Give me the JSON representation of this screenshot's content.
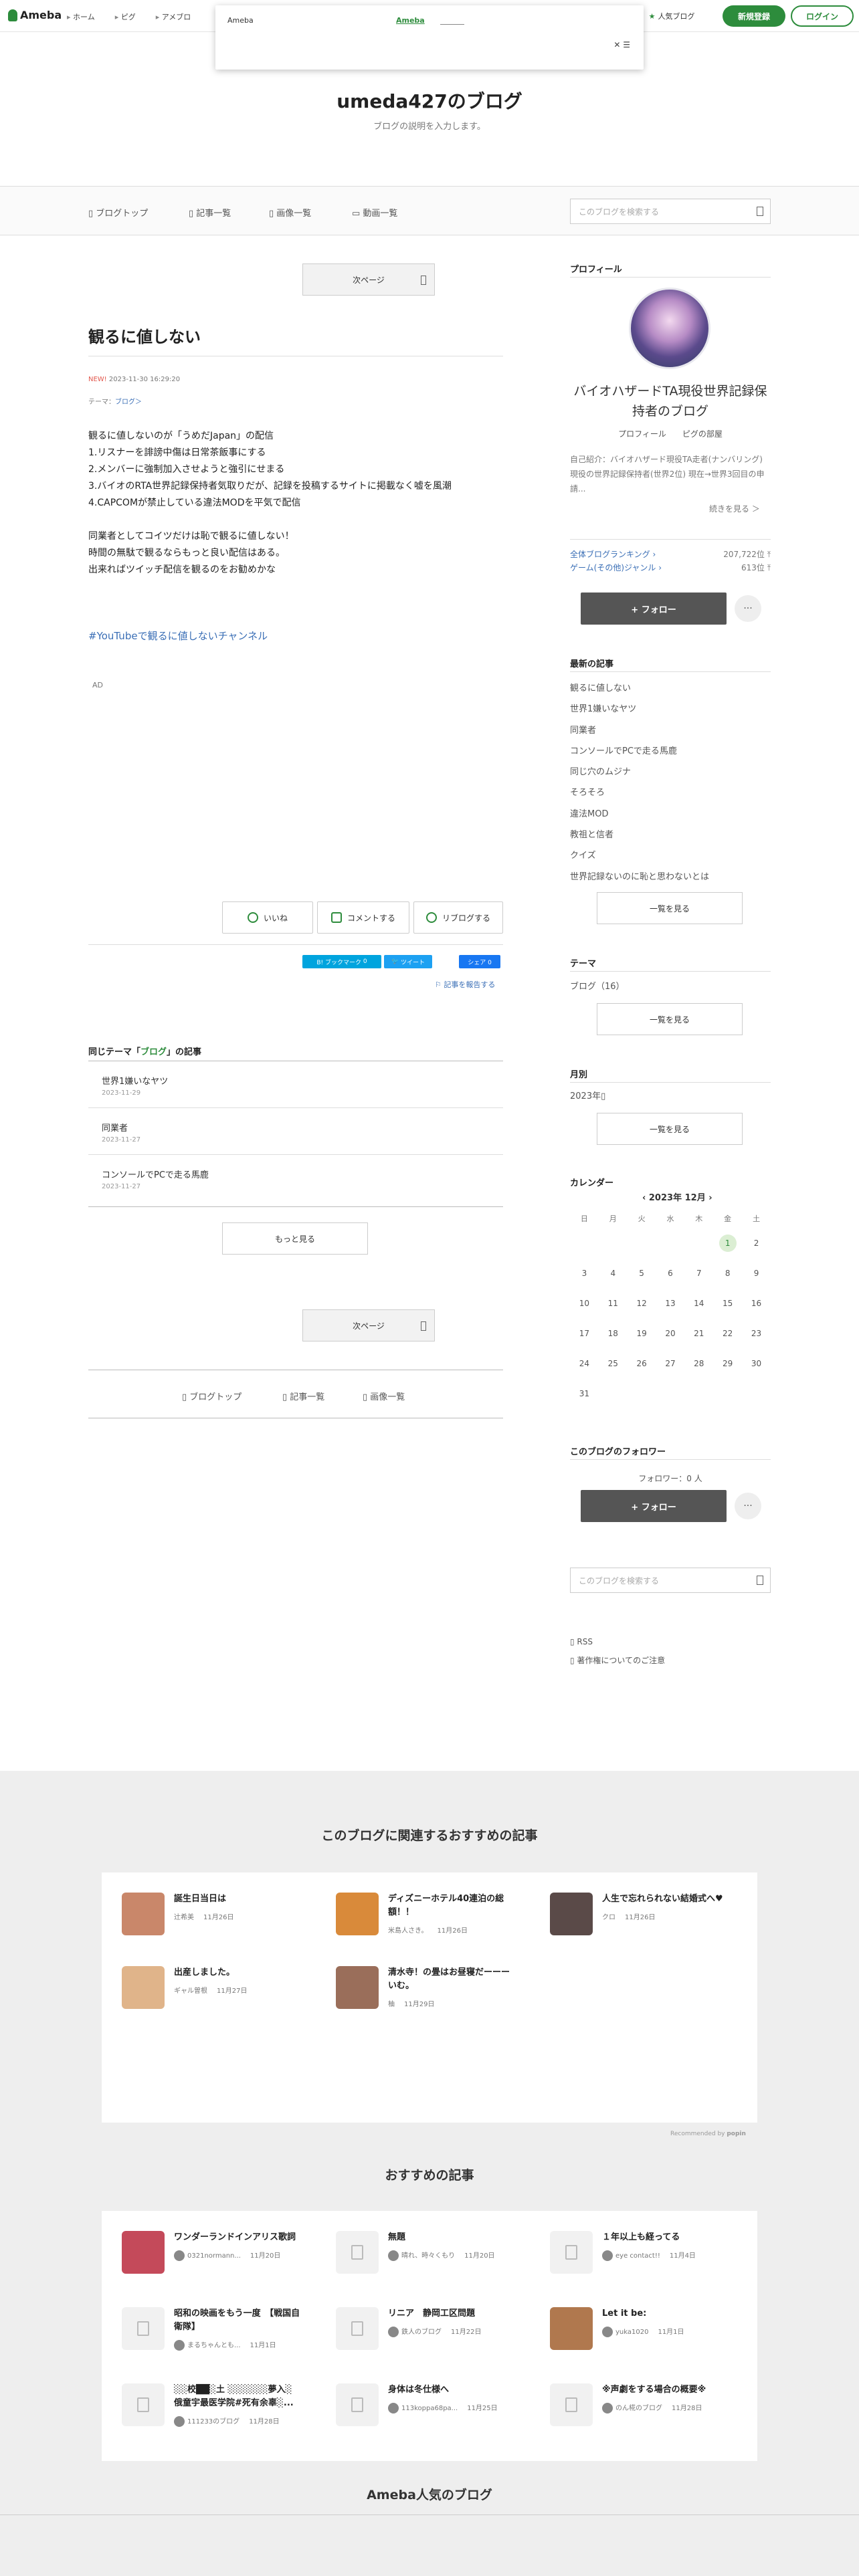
{
  "global_header": {
    "logo": "Ameba",
    "nav": [
      "ホーム",
      "ピグ",
      "アメブロ"
    ],
    "popular_label": "人気ブログ",
    "signup_label": "新規登録",
    "login_label": "ログイン",
    "popup": {
      "left_text": "Ameba",
      "link_text": "Ameba",
      "close_label": "✕"
    }
  },
  "blog": {
    "title": "umeda427のブログ",
    "description": "ブログの説明を入力します。"
  },
  "blog_nav": {
    "items": [
      "ブログトップ",
      "記事一覧",
      "画像一覧",
      "動画一覧"
    ],
    "search_placeholder": "このブログを検索する"
  },
  "article": {
    "next_page": "次ページ",
    "title": "観るに値しない",
    "new_badge": "NEW!",
    "date": "2023-11-30 16:29:20",
    "theme_label": "テーマ：",
    "theme": "ブログ",
    "body_lines": [
      "観るに値しないのが「うめだJapan」の配信",
      "1.リスナーを誹謗中傷は日常茶飯事にする",
      "2.メンバーに強制加入させようと強引にせまる",
      "3.バイオのRTA世界記録保持者気取りだが、記録を投稿するサイトに掲載なく嘘を風潮",
      "4.CAPCOMが禁止している違法MODを平気で配信",
      "",
      "同業者としてコイツだけは恥で観るに値しない！",
      "時間の無駄で観るならもっと良い配信はある。",
      "出来ればツイッチ配信を観るのをお勧めかな"
    ],
    "hashtag": "#YouTubeで観るに値しないチャンネル",
    "ad_label": "AD",
    "actions": [
      "いいね",
      "コメントする",
      "リブログする"
    ],
    "social": {
      "hatena": "B! ブックマーク",
      "hatena_count": "0",
      "tweet": "ツイート",
      "fb": "シェア 0"
    },
    "report": "記事を報告する",
    "same_theme_prefix": "同じテーマ「",
    "same_theme_name": "ブログ",
    "same_theme_suffix": "」の記事",
    "related": [
      {
        "title": "世界1嫌いなヤツ",
        "date": "2023-11-29"
      },
      {
        "title": "同業者",
        "date": "2023-11-27"
      },
      {
        "title": "コンソールでPCで走る馬鹿",
        "date": "2023-11-27"
      }
    ],
    "more_label": "もっと見る",
    "footer_nav": [
      "ブログトップ",
      "記事一覧",
      "画像一覧"
    ]
  },
  "sidebar": {
    "profile_heading": "プロフィール",
    "profile_name": "バイオハザードTA現役世界記録保持者のブログ",
    "profile_links": [
      "プロフィール",
      "ピグの部屋"
    ],
    "profile_intro": "自己紹介：バイオハザード現役TA走者(ナンバリング) 現役の世界記録保持者(世界2位) 現在→世界3回目の申請...",
    "read_more": "続きを見る ＞",
    "ranks": [
      {
        "label": "全体ブログランキング",
        "value": "207,722位"
      },
      {
        "label": "ゲーム(その他)ジャンル",
        "value": "613位"
      }
    ],
    "follow_label": "+ フォロー",
    "dots_label": "···",
    "recent_heading": "最新の記事",
    "recent": [
      "観るに値しない",
      "世界1嫌いなヤツ",
      "同業者",
      "コンソールでPCで走る馬鹿",
      "同じ穴のムジナ",
      "そろそろ",
      "違法MOD",
      "教祖と信者",
      "クイズ",
      "世界記録ないのに恥と思わないとは"
    ],
    "list_all": "一覧を見る",
    "theme_heading": "テーマ",
    "theme_item": "ブログ（16）",
    "monthly_heading": "月別",
    "monthly_item": "2023年",
    "calendar_heading": "カレンダー",
    "calendar_month": "2023年 12月",
    "weekdays": [
      "日",
      "月",
      "火",
      "水",
      "木",
      "金",
      "土"
    ],
    "calendar_rows": [
      [
        "",
        "",
        "",
        "",
        "",
        "1",
        "2"
      ],
      [
        "3",
        "4",
        "5",
        "6",
        "7",
        "8",
        "9"
      ],
      [
        "10",
        "11",
        "12",
        "13",
        "14",
        "15",
        "16"
      ],
      [
        "17",
        "18",
        "19",
        "20",
        "21",
        "22",
        "23"
      ],
      [
        "24",
        "25",
        "26",
        "27",
        "28",
        "29",
        "30"
      ],
      [
        "31",
        "",
        "",
        "",
        "",
        "",
        ""
      ]
    ],
    "followers_heading": "このブログのフォロワー",
    "followers_count": "フォロワー：0 人",
    "rss": "RSS",
    "copyright": "著作権についてのご注意"
  },
  "recommend": {
    "related_heading": "このブログに関連するおすすめの記事",
    "related_items": [
      {
        "title": "誕生日当日は",
        "author": "辻希美",
        "date": "11月26日",
        "color": "#c9876a"
      },
      {
        "title": "ディズニーホテル40連泊の総額！！",
        "author": "米島人さき。",
        "date": "11月26日",
        "color": "#d98a3a"
      },
      {
        "title": "人生で忘れられない結婚式へ♥",
        "author": "クロ",
        "date": "11月26日",
        "color": "#5a4a48"
      },
      {
        "title": "出産しました。",
        "author": "ギャル曽根",
        "date": "11月27日",
        "color": "#e0b48a"
      },
      {
        "title": "清水寺！の畳はお昼寝だーーーいむ。",
        "author": "柚",
        "date": "11月29日",
        "color": "#9a6e5a"
      }
    ],
    "recommended_by": "Recommended by",
    "popin": "popin",
    "osusume_heading": "おすすめの記事",
    "osusume_items": [
      {
        "title": "ワンダーランドインアリス歌詞",
        "author": "0321normann...",
        "date": "11月20日",
        "color": "#c44a5a",
        "img": true
      },
      {
        "title": "無題",
        "author": "晴れ、時々くもり",
        "date": "11月20日",
        "img": false
      },
      {
        "title": "１年以上も経ってる",
        "author": "eye contact!!",
        "date": "11月4日",
        "img": false
      },
      {
        "title": "昭和の映画をもう一度　【戦国自衛隊】",
        "author": "まるちゃんとも...",
        "date": "11月1日",
        "img": false
      },
      {
        "title": "リニア　静岡工区問題",
        "author": "鉄人のブログ",
        "date": "11月22日",
        "img": false
      },
      {
        "title": "Let it be:",
        "author": "yuka1020",
        "date": "11月1日",
        "color": "#b0784e",
        "img": true
      },
      {
        "title": "░░校██░土 ░░░░░░夢入░ 俄童宇最医学院#死有余辜░...",
        "author": "111233のブログ",
        "date": "11月28日",
        "img": false
      },
      {
        "title": "身体は冬仕様へ",
        "author": "113koppa68pa...",
        "date": "11月25日",
        "img": false
      },
      {
        "title": "※声劇をする場合の概要※",
        "author": "のん椛のブログ",
        "date": "11月28日",
        "img": false
      }
    ],
    "popular_heading": "Ameba人気のブログ"
  }
}
